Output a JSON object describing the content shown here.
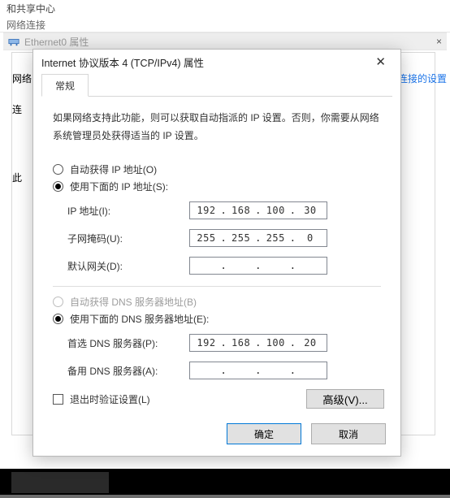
{
  "bg": {
    "path_row1": "和共享中心",
    "path_row2": "网络连接",
    "adapter_name": "Ethernet0 属性",
    "tab_wl": "网络",
    "label_lj": "连",
    "label_ci": "此",
    "right_link": "改此连接的设置"
  },
  "dialog": {
    "title": "Internet 协议版本 4 (TCP/IPv4) 属性",
    "tab_general": "常规",
    "description": "如果网络支持此功能，则可以获取自动指派的 IP 设置。否则，你需要从网络系统管理员处获得适当的 IP 设置。",
    "ip": {
      "radio_auto": "自动获得 IP 地址(O)",
      "radio_manual": "使用下面的 IP 地址(S):",
      "label_ip": "IP 地址(I):",
      "label_mask": "子网掩码(U):",
      "label_gw": "默认网关(D):",
      "val_ip": [
        "192",
        "168",
        "100",
        "30"
      ],
      "val_mask": [
        "255",
        "255",
        "255",
        "0"
      ],
      "val_gw": [
        "",
        "",
        "",
        ""
      ]
    },
    "dns": {
      "radio_auto": "自动获得 DNS 服务器地址(B)",
      "radio_manual": "使用下面的 DNS 服务器地址(E):",
      "label_pref": "首选 DNS 服务器(P):",
      "label_alt": "备用 DNS 服务器(A):",
      "val_pref": [
        "192",
        "168",
        "100",
        "20"
      ],
      "val_alt": [
        "",
        "",
        "",
        ""
      ]
    },
    "chk_verify": "退出时验证设置(L)",
    "btn_adv": "高级(V)...",
    "btn_ok": "确定",
    "btn_cancel": "取消"
  }
}
